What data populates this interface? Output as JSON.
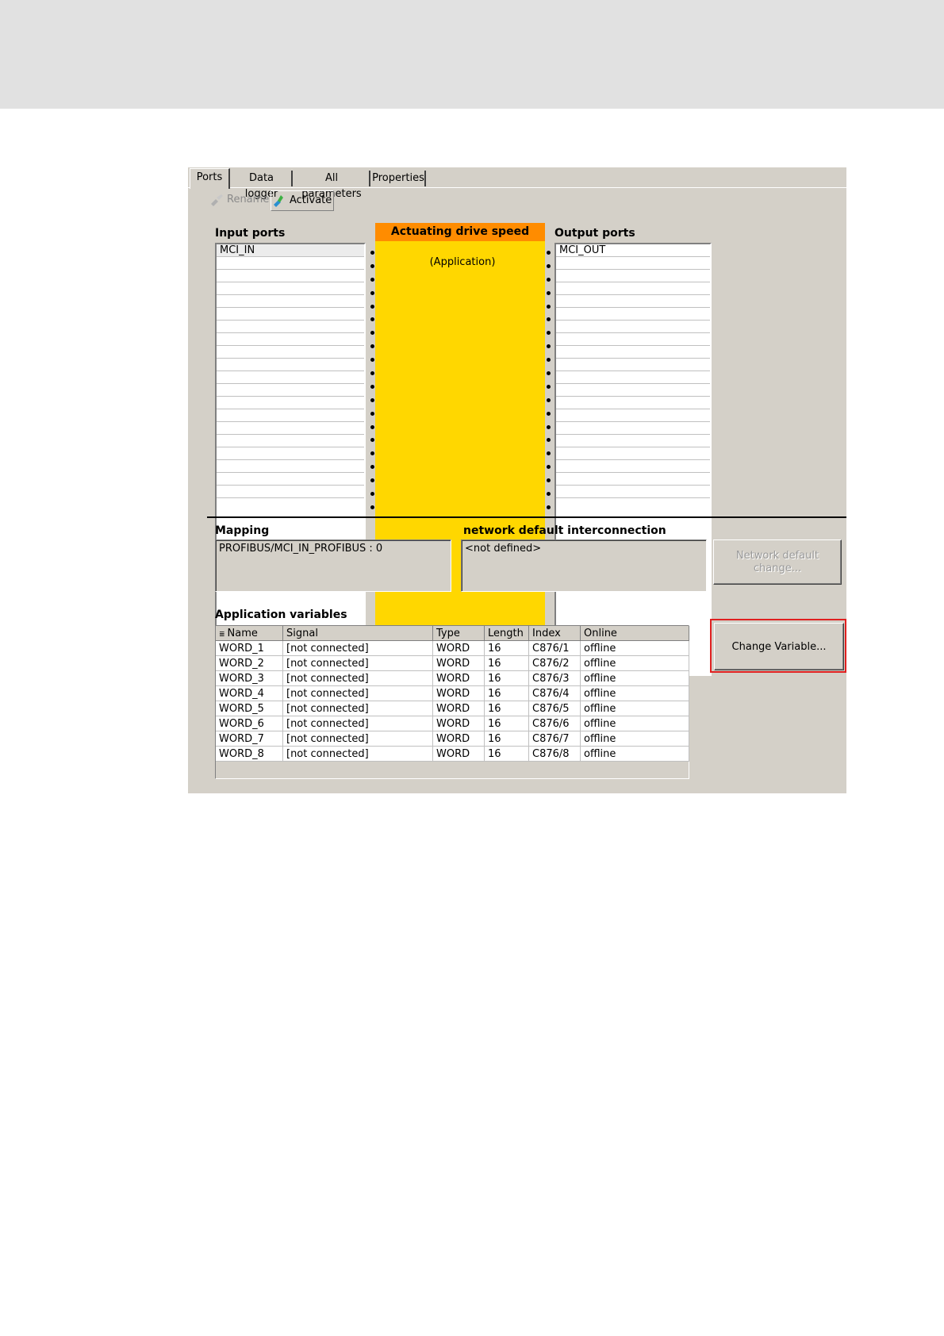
{
  "tabs": [
    "Ports",
    "Data logger",
    "All parameters",
    "Properties"
  ],
  "toolbar": {
    "rename_label": "Rename",
    "activate_label": "Activate"
  },
  "input_ports": {
    "label": "Input ports",
    "items": [
      "MCI_IN"
    ]
  },
  "block": {
    "title": "Actuating drive speed",
    "subtitle": "(Application)"
  },
  "output_ports": {
    "label": "Output ports",
    "items": [
      "MCI_OUT"
    ]
  },
  "mapping": {
    "label": "Mapping",
    "value": "PROFIBUS/MCI_IN_PROFIBUS : 0"
  },
  "network": {
    "label": "network default interconnection",
    "value": "<not defined>",
    "button_line1": "Network default",
    "button_line2": "change..."
  },
  "app_vars": {
    "label": "Application variables",
    "columns": [
      "Name",
      "Signal",
      "Type",
      "Length",
      "Index",
      "Online"
    ],
    "rows": [
      [
        "WORD_1",
        "[not connected]",
        "WORD",
        "16",
        "C876/1",
        "offline"
      ],
      [
        "WORD_2",
        "[not connected]",
        "WORD",
        "16",
        "C876/2",
        "offline"
      ],
      [
        "WORD_3",
        "[not connected]",
        "WORD",
        "16",
        "C876/3",
        "offline"
      ],
      [
        "WORD_4",
        "[not connected]",
        "WORD",
        "16",
        "C876/4",
        "offline"
      ],
      [
        "WORD_5",
        "[not connected]",
        "WORD",
        "16",
        "C876/5",
        "offline"
      ],
      [
        "WORD_6",
        "[not connected]",
        "WORD",
        "16",
        "C876/6",
        "offline"
      ],
      [
        "WORD_7",
        "[not connected]",
        "WORD",
        "16",
        "C876/7",
        "offline"
      ],
      [
        "WORD_8",
        "[not connected]",
        "WORD",
        "16",
        "C876/8",
        "offline"
      ]
    ],
    "change_button": "Change Variable..."
  },
  "colors": {
    "block_head": "#ff8c00",
    "block_body": "#ffd700",
    "highlight": "#e02020",
    "window_bg": "#d4d0c8"
  }
}
